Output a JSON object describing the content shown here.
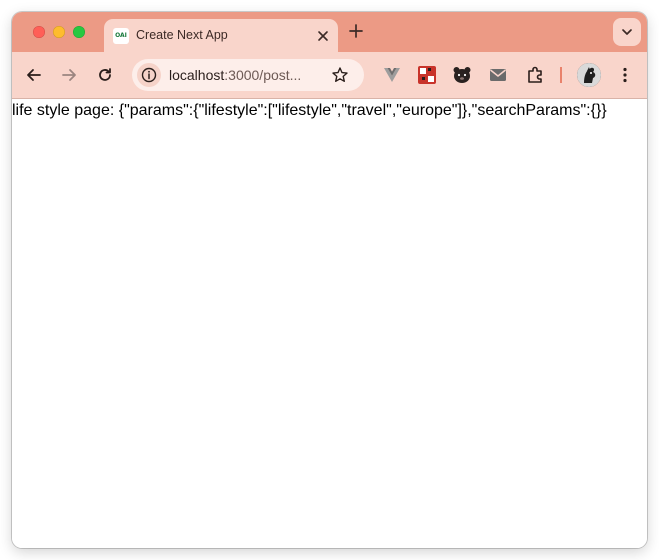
{
  "tab": {
    "favicon_text": "OAI",
    "title": "Create Next App"
  },
  "address_bar": {
    "host": "localhost",
    "path": ":3000/post..."
  },
  "page": {
    "body_text": "life style page: {\"params\":{\"lifestyle\":[\"lifestyle\",\"travel\",\"europe\"]},\"searchParams\":{}}"
  },
  "extensions": [
    "vue-devtools-icon",
    "puzzle-game-icon",
    "bear-icon",
    "mail-icon",
    "extensions-icon"
  ],
  "colors": {
    "tab_strip": "#ec9a85",
    "toolbar": "#f9d5cb",
    "omnibox": "#fdeeea"
  }
}
